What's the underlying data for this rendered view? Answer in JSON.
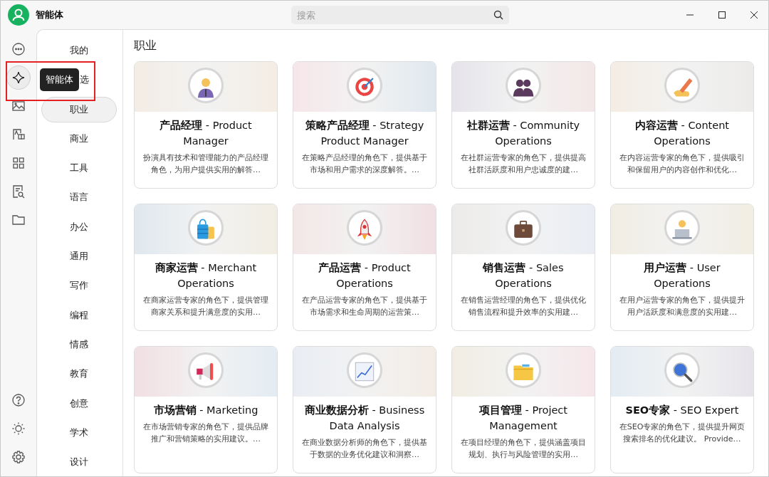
{
  "window": {
    "title": "智能体"
  },
  "search": {
    "placeholder": "搜索"
  },
  "rail": {
    "top": [
      {
        "kind": "chat",
        "selected": false
      },
      {
        "kind": "agent",
        "selected": true
      },
      {
        "kind": "image",
        "selected": false
      },
      {
        "kind": "translate",
        "selected": false
      },
      {
        "kind": "apps",
        "selected": false
      },
      {
        "kind": "docsearch",
        "selected": false
      },
      {
        "kind": "folder",
        "selected": false
      }
    ],
    "bottom": [
      {
        "kind": "help"
      },
      {
        "kind": "theme"
      },
      {
        "kind": "settings"
      }
    ]
  },
  "tooltip": {
    "text": "智能体",
    "highlighted": true
  },
  "categories": [
    {
      "label": "我的",
      "selected": false,
      "covered": false
    },
    {
      "label": "选",
      "selected": false,
      "covered": true
    },
    {
      "label": "职业",
      "selected": true,
      "covered": false
    },
    {
      "label": "商业",
      "selected": false,
      "covered": false
    },
    {
      "label": "工具",
      "selected": false,
      "covered": false
    },
    {
      "label": "语言",
      "selected": false,
      "covered": false
    },
    {
      "label": "办公",
      "selected": false,
      "covered": false
    },
    {
      "label": "通用",
      "selected": false,
      "covered": false
    },
    {
      "label": "写作",
      "selected": false,
      "covered": false
    },
    {
      "label": "编程",
      "selected": false,
      "covered": false
    },
    {
      "label": "情感",
      "selected": false,
      "covered": false
    },
    {
      "label": "教育",
      "selected": false,
      "covered": false
    },
    {
      "label": "创意",
      "selected": false,
      "covered": false
    },
    {
      "label": "学术",
      "selected": false,
      "covered": false
    },
    {
      "label": "设计",
      "selected": false,
      "covered": false
    }
  ],
  "section_title": "职业",
  "agents": [
    {
      "title": "**产品经理** - Product Manager",
      "description": "扮演具有技术和管理能力的产品经理角色，为用户提供实用的解答…"
    },
    {
      "title": "**策略产品经理** - Strategy Product Manager",
      "description": "在策略产品经理的角色下，提供基于市场和用户需求的深度解答。…"
    },
    {
      "title": "**社群运营** - Community Operations",
      "description": "在社群运营专家的角色下，提供提高社群活跃度和用户忠诚度的建…"
    },
    {
      "title": "**内容运营** - Content Operations",
      "description": "在内容运营专家的角色下，提供吸引和保留用户的内容创作和优化…"
    },
    {
      "title": "**商家运营** - Merchant Operations",
      "description": "在商家运营专家的角色下，提供管理商家关系和提升满意度的实用…"
    },
    {
      "title": "**产品运营** - Product Operations",
      "description": "在产品运营专家的角色下，提供基于市场需求和生命周期的运营策…"
    },
    {
      "title": "**销售运营** - Sales Operations",
      "description": "在销售运营经理的角色下，提供优化销售流程和提升效率的实用建…"
    },
    {
      "title": "**用户运营** - User Operations",
      "description": "在用户运营专家的角色下，提供提升用户活跃度和满意度的实用建…"
    },
    {
      "title": "**市场营销** - Marketing",
      "description": "在市场营销专家的角色下，提供品牌推广和营销策略的实用建议。…"
    },
    {
      "title": "**商业数据分析** - Business Data Analysis",
      "description": "在商业数据分析师的角色下，提供基于数据的业务优化建议和洞察…"
    },
    {
      "title": "**项目管理** - Project Management",
      "description": "在项目经理的角色下，提供涵盖项目规划、执行与风险管理的实用…"
    },
    {
      "title": "**SEO专家** - SEO Expert",
      "description": "在SEO专家的角色下，提供提升网页搜索排名的优化建议。 Provide…"
    }
  ]
}
